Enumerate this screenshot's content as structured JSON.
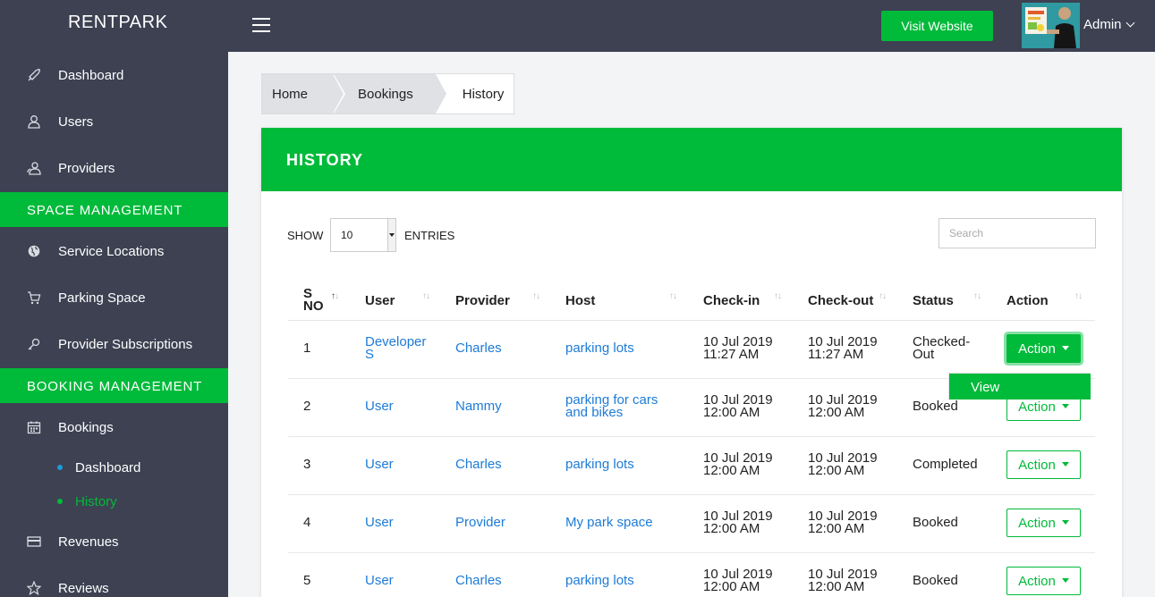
{
  "app": {
    "brand": "RENTPARK"
  },
  "header": {
    "visit_label": "Visit Website",
    "user_name": "Admin"
  },
  "sidebar": {
    "items_top": [
      {
        "label": "Dashboard",
        "icon": "rocket-icon"
      },
      {
        "label": "Users",
        "icon": "user-icon"
      },
      {
        "label": "Providers",
        "icon": "users-icon"
      }
    ],
    "section_space": "SPACE MANAGEMENT",
    "items_space": [
      {
        "label": "Service Locations",
        "icon": "globe-icon"
      },
      {
        "label": "Parking Space",
        "icon": "cart-icon"
      },
      {
        "label": "Provider Subscriptions",
        "icon": "key-icon"
      }
    ],
    "section_booking": "BOOKING MANAGEMENT",
    "bookings": {
      "label": "Bookings",
      "icon": "calendar-icon"
    },
    "sub_items": [
      {
        "label": "Dashboard",
        "active": false,
        "color": "#1d9bd6"
      },
      {
        "label": "History",
        "active": true,
        "color": "#00ba3a"
      }
    ],
    "items_bottom": [
      {
        "label": "Revenues",
        "icon": "credit-card-icon"
      },
      {
        "label": "Reviews",
        "icon": "star-icon"
      }
    ]
  },
  "breadcrumb": [
    "Home",
    "Bookings",
    "History"
  ],
  "card": {
    "title": "HISTORY",
    "show_label": "SHOW",
    "page_length": "10",
    "entries_label": "ENTRIES",
    "search_placeholder": "Search"
  },
  "table": {
    "columns": [
      "S NO",
      "User",
      "Provider",
      "Host",
      "Check-in",
      "Check-out",
      "Status",
      "Action"
    ],
    "rows": [
      {
        "sno": "1",
        "user": "Developer S",
        "provider": "Charles",
        "host": "parking lots",
        "checkin_date": "10 Jul 2019",
        "checkin_time": "11:27 AM",
        "checkout_date": "10 Jul 2019",
        "checkout_time": "11:27 AM",
        "status": "Checked-Out",
        "action": "Action"
      },
      {
        "sno": "2",
        "user": "User",
        "provider": "Nammy",
        "host": "parking for cars and bikes",
        "checkin_date": "10 Jul 2019",
        "checkin_time": "12:00 AM",
        "checkout_date": "10 Jul 2019",
        "checkout_time": "12:00 AM",
        "status": "Booked",
        "action": "Action"
      },
      {
        "sno": "3",
        "user": "User",
        "provider": "Charles",
        "host": "parking lots",
        "checkin_date": "10 Jul 2019",
        "checkin_time": "12:00 AM",
        "checkout_date": "10 Jul 2019",
        "checkout_time": "12:00 AM",
        "status": "Completed",
        "action": "Action"
      },
      {
        "sno": "4",
        "user": "User",
        "provider": "Provider",
        "host": "My park space",
        "checkin_date": "10 Jul 2019",
        "checkin_time": "12:00 AM",
        "checkout_date": "10 Jul 2019",
        "checkout_time": "12:00 AM",
        "status": "Booked",
        "action": "Action"
      },
      {
        "sno": "5",
        "user": "User",
        "provider": "Charles",
        "host": "parking lots",
        "checkin_date": "10 Jul 2019",
        "checkin_time": "12:00 AM",
        "checkout_date": "10 Jul 2019",
        "checkout_time": "12:00 AM",
        "status": "Booked",
        "action": "Action"
      }
    ]
  },
  "dropdown": {
    "view_label": "View"
  },
  "colors": {
    "accent": "#00ba3a",
    "sidebar": "#3d4152",
    "link": "#1d7bd6"
  }
}
